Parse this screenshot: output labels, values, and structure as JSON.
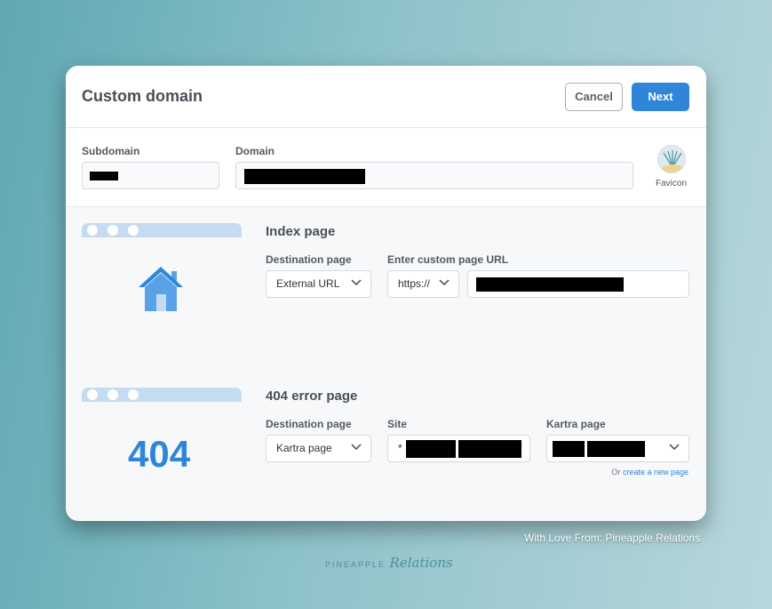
{
  "modal": {
    "title": "Custom domain",
    "cancel_label": "Cancel",
    "next_label": "Next"
  },
  "domain": {
    "subdomain_label": "Subdomain",
    "domain_label": "Domain",
    "favicon_label": "Favicon"
  },
  "index_page": {
    "title": "Index page",
    "destination_label": "Destination page",
    "destination_value": "External URL",
    "custom_url_label": "Enter custom page URL",
    "protocol_value": "https://",
    "icon": "house-icon"
  },
  "error_page": {
    "title": "404 error page",
    "big_text": "404",
    "destination_label": "Destination page",
    "destination_value": "Kartra page",
    "site_label": "Site",
    "site_prefix": "*",
    "kartra_page_label": "Kartra page",
    "create_hint_prefix": "Or",
    "create_link": "create a new page"
  },
  "footer": {
    "credit": "With Love From: Pineapple Relations",
    "brand_word": "PINEAPPLE",
    "brand_script": "Relations"
  },
  "colors": {
    "accent": "#2f86d9",
    "browser_bar": "#c5dcf0"
  }
}
